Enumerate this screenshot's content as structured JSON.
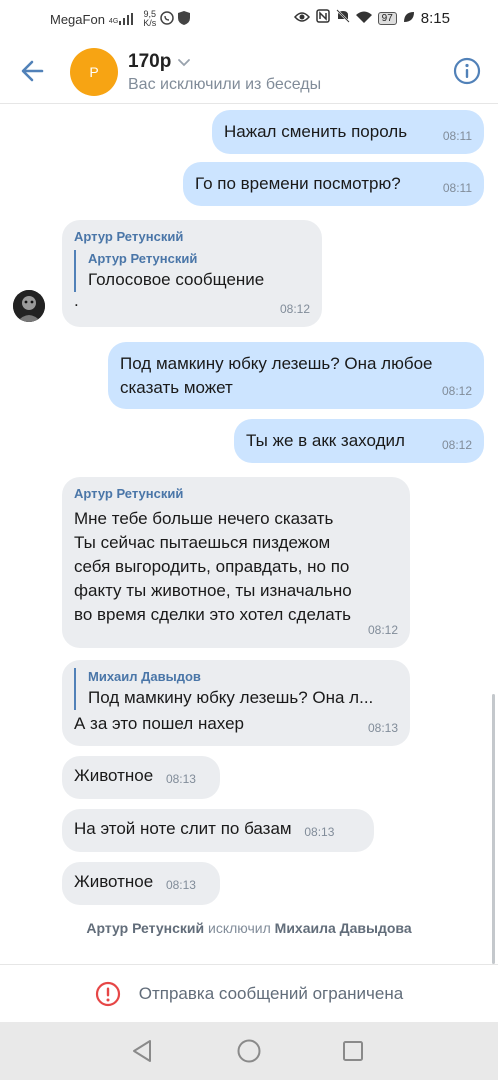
{
  "status_bar": {
    "carrier": "MegaFon",
    "signal": "4G",
    "net_speed_value": "9,5",
    "net_speed_unit": "K/s",
    "battery": "97",
    "time": "8:15"
  },
  "header": {
    "avatar_letter": "Р",
    "title": "170р",
    "subtitle": "Вас исключили из беседы"
  },
  "messages": [
    {
      "direction": "out",
      "text": "Нажал сменить пороль",
      "time": "08:11"
    },
    {
      "direction": "out",
      "text": "Го по времени посмотрю?",
      "time": "08:11"
    },
    {
      "direction": "in",
      "sender": "Артур Ретунский",
      "quote_name": "Артур Ретунский",
      "quote_text": "Голосовое сообщение",
      "text": ".",
      "time": "08:12"
    },
    {
      "direction": "out",
      "text_lines": [
        "Под мамкину юбку лезешь? Она любое",
        "сказать может"
      ],
      "time": "08:12"
    },
    {
      "direction": "out",
      "text": "Ты же в акк заходил",
      "time": "08:12"
    },
    {
      "direction": "in",
      "sender": "Артур Ретунский",
      "text_lines": [
        "Мне тебе больше нечего сказать",
        "Ты сейчас пытаешься пиздежом",
        "себя выгородить, оправдать, но по",
        "факту ты животное, ты изначально",
        "во время сделки это хотел сделать"
      ],
      "time": "08:12"
    },
    {
      "direction": "in",
      "quote_name": "Михаил Давыдов",
      "quote_text": "Под мамкину юбку лезешь? Она л...",
      "text": "А за это пошел нахер",
      "time": "08:13"
    },
    {
      "direction": "in",
      "text": "Животное",
      "time": "08:13"
    },
    {
      "direction": "in",
      "text": "На этой ноте слит по базам",
      "time": "08:13"
    },
    {
      "direction": "in",
      "text": "Животное",
      "time": "08:13"
    }
  ],
  "service_message": {
    "actor": "Артур Ретунский",
    "action": "исключил",
    "target": "Михаила Давыдова"
  },
  "restriction": {
    "text": "Отправка сообщений ограничена"
  },
  "colors": {
    "accent": "#5181b8",
    "avatar_bg": "#f7a413",
    "out_bubble": "#cce4ff",
    "in_bubble": "#ebedf0",
    "restriction_icon": "#e64646"
  }
}
